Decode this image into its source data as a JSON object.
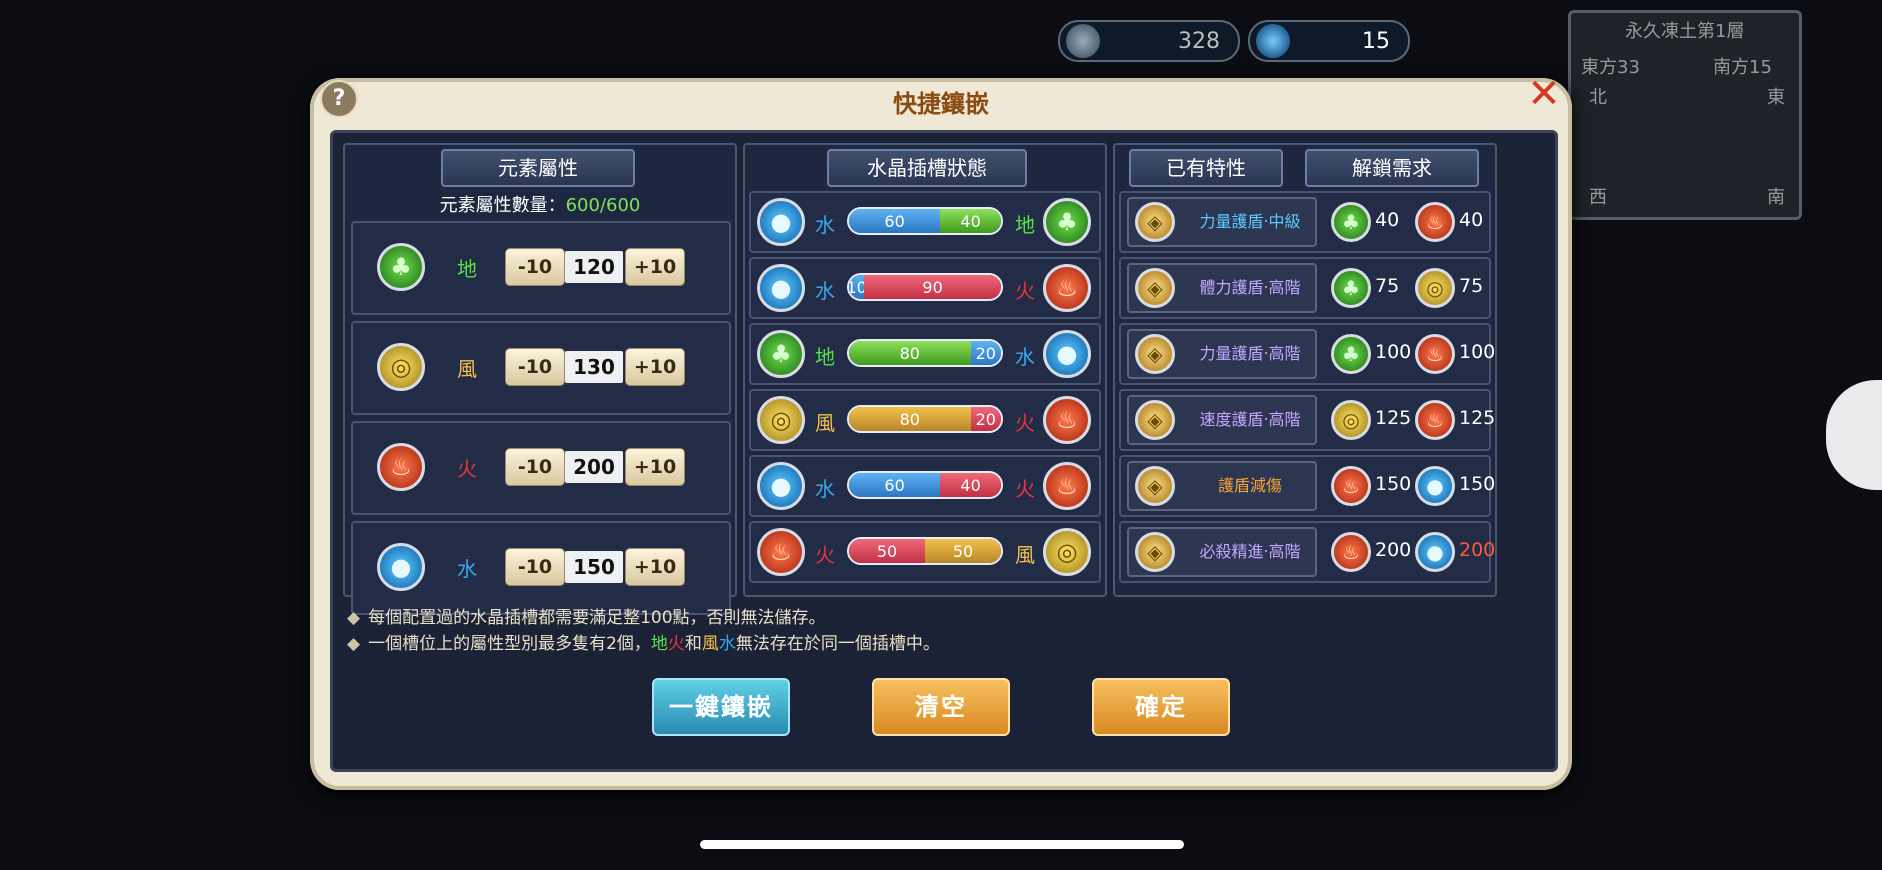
{
  "hud": {
    "stone_count": "328",
    "crystal_count": "15",
    "map_title": "永久凍土第1層",
    "map_coord_x": "東方33",
    "map_coord_y": "南方15",
    "map_north": "北",
    "map_east": "東",
    "map_west": "西",
    "map_south": "南"
  },
  "dialog": {
    "title": "快捷鑲嵌",
    "help_icon": "question-icon",
    "close_icon": "close-icon"
  },
  "elements_panel": {
    "header": "元素屬性",
    "count_label": "元素屬性數量：",
    "count_value": "600/600",
    "rows": [
      {
        "element": "earth",
        "label": "地",
        "minus": "-10",
        "value": "120",
        "plus": "+10",
        "color": "#5be04a"
      },
      {
        "element": "wind",
        "label": "風",
        "minus": "-10",
        "value": "130",
        "plus": "+10",
        "color": "#f2c14a"
      },
      {
        "element": "fire",
        "label": "火",
        "minus": "-10",
        "value": "200",
        "plus": "+10",
        "color": "#e8343a"
      },
      {
        "element": "water",
        "label": "水",
        "minus": "-10",
        "value": "150",
        "plus": "+10",
        "color": "#3aa8ef"
      }
    ]
  },
  "slots_panel": {
    "header": "水晶插槽狀態",
    "rows": [
      {
        "left": "water",
        "left_label": "水",
        "a": 60,
        "b": 40,
        "right": "earth",
        "right_label": "地"
      },
      {
        "left": "water",
        "left_label": "水",
        "a": 10,
        "b": 90,
        "right": "fire",
        "right_label": "火"
      },
      {
        "left": "earth",
        "left_label": "地",
        "a": 80,
        "b": 20,
        "right": "water",
        "right_label": "水"
      },
      {
        "left": "wind",
        "left_label": "風",
        "a": 80,
        "b": 20,
        "right": "fire",
        "right_label": "火"
      },
      {
        "left": "water",
        "left_label": "水",
        "a": 60,
        "b": 40,
        "right": "fire",
        "right_label": "火"
      },
      {
        "left": "fire",
        "left_label": "火",
        "a": 50,
        "b": 50,
        "right": "wind",
        "right_label": "風"
      }
    ]
  },
  "traits_panel": {
    "header_traits": "已有特性",
    "header_unlock": "解鎖需求",
    "rows": [
      {
        "name": "力量護盾‧中級",
        "name_color": "#5fc8ff",
        "req1_el": "earth",
        "req1": "40",
        "req2_el": "fire",
        "req2": "40",
        "req2_color": "#ffffff"
      },
      {
        "name": "體力護盾‧高階",
        "name_color": "#c3a6ff",
        "req1_el": "earth",
        "req1": "75",
        "req2_el": "wind",
        "req2": "75",
        "req2_color": "#ffffff"
      },
      {
        "name": "力量護盾‧高階",
        "name_color": "#c3a6ff",
        "req1_el": "earth",
        "req1": "100",
        "req2_el": "fire",
        "req2": "100",
        "req2_color": "#ffffff"
      },
      {
        "name": "速度護盾‧高階",
        "name_color": "#c3a6ff",
        "req1_el": "wind",
        "req1": "125",
        "req2_el": "fire",
        "req2": "125",
        "req2_color": "#ffffff"
      },
      {
        "name": "護盾減傷",
        "name_color": "#f2a23a",
        "req1_el": "fire",
        "req1": "150",
        "req2_el": "water",
        "req2": "150",
        "req2_color": "#ffffff"
      },
      {
        "name": "必殺精進‧高階",
        "name_color": "#c3a6ff",
        "req1_el": "fire",
        "req1": "200",
        "req2_el": "water",
        "req2": "200",
        "req2_color": "#ff5a3a"
      }
    ]
  },
  "notes": {
    "line1": "每個配置過的水晶插槽都需要滿足整100點，否則無法儲存。",
    "line2_prefix": "一個槽位上的屬性型別最多隻有2個，",
    "line2_earth": "地",
    "line2_fire": "火",
    "line2_and": "和",
    "line2_wind": "風",
    "line2_water": "水",
    "line2_suffix": "無法存在於同一個插槽中。"
  },
  "buttons": {
    "auto_embed": "一鍵鑲嵌",
    "clear": "清空",
    "confirm": "確定"
  },
  "colors": {
    "earth": "#5be04a",
    "wind": "#f2c14a",
    "fire": "#e8343a",
    "water": "#3aa8ef",
    "count_green": "#7ee05a"
  }
}
